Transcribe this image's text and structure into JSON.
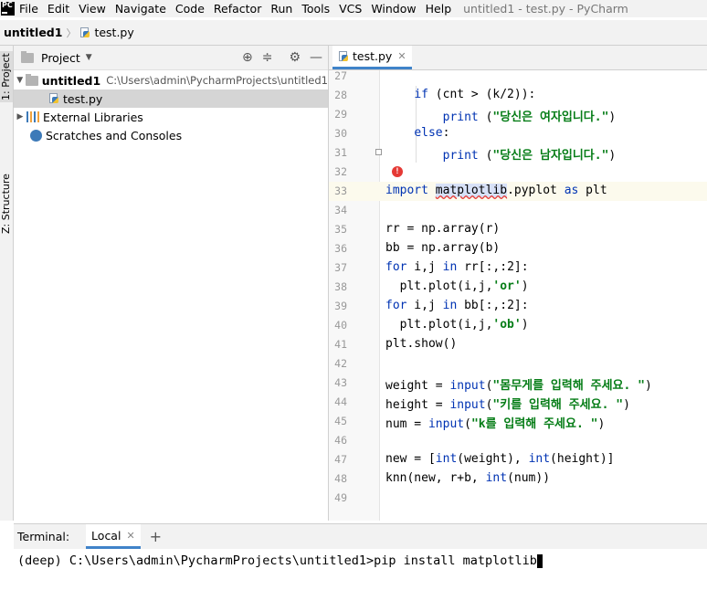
{
  "menubar": {
    "app_icon": "PC",
    "items": [
      "File",
      "Edit",
      "View",
      "Navigate",
      "Code",
      "Refactor",
      "Run",
      "Tools",
      "VCS",
      "Window",
      "Help"
    ],
    "window_title": "untitled1 - test.py - PyCharm"
  },
  "navbar": {
    "project": "untitled1",
    "file": "test.py"
  },
  "left_strip": {
    "project_tab": "1: Project",
    "structure_tab": "Z: Structure"
  },
  "project_panel": {
    "title": "Project",
    "tree": [
      {
        "label": "untitled1",
        "path": "C:\\Users\\admin\\PycharmProjects\\untitled1"
      },
      {
        "label": "test.py"
      },
      {
        "label": "External Libraries"
      },
      {
        "label": "Scratches and Consoles"
      }
    ]
  },
  "editor": {
    "tab_label": "test.py",
    "lines": [
      {
        "no": "27",
        "code": ""
      },
      {
        "no": "28",
        "code": "    if (cnt > (k/2)):"
      },
      {
        "no": "29",
        "code": "        print (\"당신은 여자입니다.\")"
      },
      {
        "no": "30",
        "code": "    else:"
      },
      {
        "no": "31",
        "code": "        print (\"당신은 남자입니다.\")"
      },
      {
        "no": "32",
        "code": ""
      },
      {
        "no": "33",
        "code": "import matplotlib.pyplot as plt"
      },
      {
        "no": "34",
        "code": ""
      },
      {
        "no": "35",
        "code": "rr = np.array(r)"
      },
      {
        "no": "36",
        "code": "bb = np.array(b)"
      },
      {
        "no": "37",
        "code": "for i,j in rr[:,:2]:"
      },
      {
        "no": "38",
        "code": "  plt.plot(i,j,'or')"
      },
      {
        "no": "39",
        "code": "for i,j in bb[:,:2]:"
      },
      {
        "no": "40",
        "code": "  plt.plot(i,j,'ob')"
      },
      {
        "no": "41",
        "code": "plt.show()"
      },
      {
        "no": "42",
        "code": ""
      },
      {
        "no": "43",
        "code": "weight = input(\"몸무게를 입력해 주세요. \")"
      },
      {
        "no": "44",
        "code": "height = input(\"키를 입력해 주세요. \")"
      },
      {
        "no": "45",
        "code": "num = input(\"k를 입력해 주세요. \")"
      },
      {
        "no": "46",
        "code": ""
      },
      {
        "no": "47",
        "code": "new = [int(weight), int(height)]"
      },
      {
        "no": "48",
        "code": "knn(new, r+b, int(num))"
      },
      {
        "no": "49",
        "code": ""
      }
    ]
  },
  "terminal": {
    "label": "Terminal:",
    "tab": "Local",
    "command": "(deep) C:\\Users\\admin\\PycharmProjects\\untitled1>pip install matplotlib"
  },
  "colors": {
    "keyword": "#0033b3",
    "string": "#067d17",
    "error": "#e53935",
    "accent": "#4083c9"
  }
}
